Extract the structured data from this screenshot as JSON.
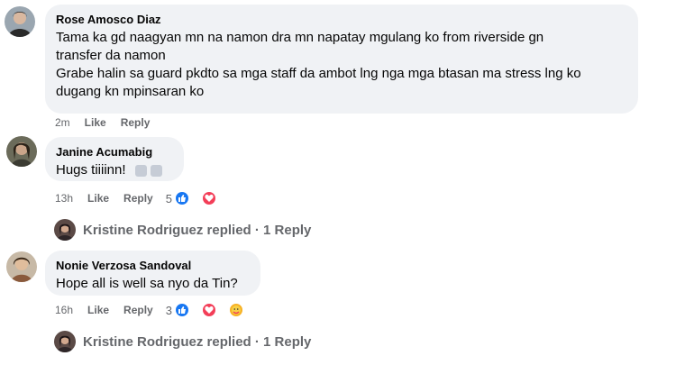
{
  "comments": [
    {
      "author": "Rose Amosco Diaz",
      "lines": [
        "Tama ka gd naagyan mn na namon dra mn napatay mgulang ko from riverside gn",
        "transfer da namon",
        "Grabe halin sa guard pkdto sa mga staff da ambot lng nga mga btasan ma stress lng ko",
        "dugang kn mpinsaran ko"
      ],
      "time": "2m",
      "like_label": "Like",
      "reply_label": "Reply"
    },
    {
      "author": "Janine Acumabig",
      "text": "Hugs tiiiinn!",
      "time": "13h",
      "like_label": "Like",
      "reply_label": "Reply",
      "reaction_count": "5",
      "reactions": [
        "like",
        "love"
      ],
      "replies_text": "Kristine Rodriguez replied · 1 Reply"
    },
    {
      "author": "Nonie Verzosa Sandoval",
      "text": "Hope all is well sa nyo da Tin?",
      "time": "16h",
      "like_label": "Like",
      "reply_label": "Reply",
      "reaction_count": "3",
      "reactions": [
        "like",
        "love",
        "care"
      ],
      "replies_text": "Kristine Rodriguez replied · 1 Reply"
    }
  ],
  "colors": {
    "bubble": "#f0f2f5",
    "meta": "#65676b",
    "like": "#1877f2",
    "love": "#f33e58",
    "care": "#f7b125"
  }
}
